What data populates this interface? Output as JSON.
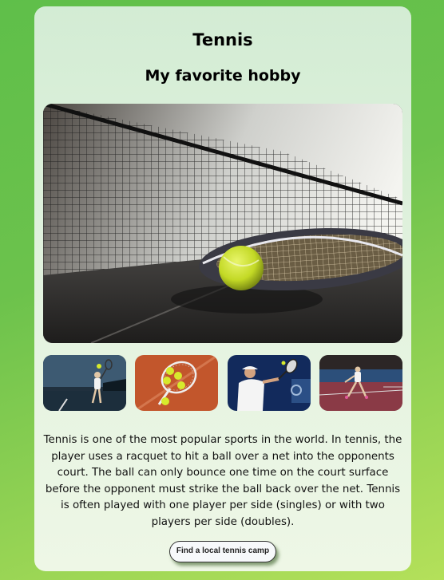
{
  "page": {
    "title": "Tennis",
    "subtitle": "My favorite hobby"
  },
  "images": {
    "hero": "tennis-racket-ball-net-photo",
    "thumbnails": [
      "player-serving-photo",
      "racket-balls-clay-photo",
      "player-backhand-photo",
      "player-indoor-court-photo"
    ]
  },
  "description": "Tennis is one of the most popular sports in the world. In tennis, the player uses a racquet to hit a ball over a net into the opponents court. The ball can only bounce one time on the court surface before the opponent must strike the ball back over the net. Tennis is often played with one player per side (singles) or with two players per side (doubles).",
  "cta": {
    "label": "Find a local tennis camp"
  },
  "colors": {
    "background_start": "#5fbf4a",
    "background_end": "#b4e05a",
    "card": "#e4f3e0",
    "ball": "#c8e02a"
  }
}
